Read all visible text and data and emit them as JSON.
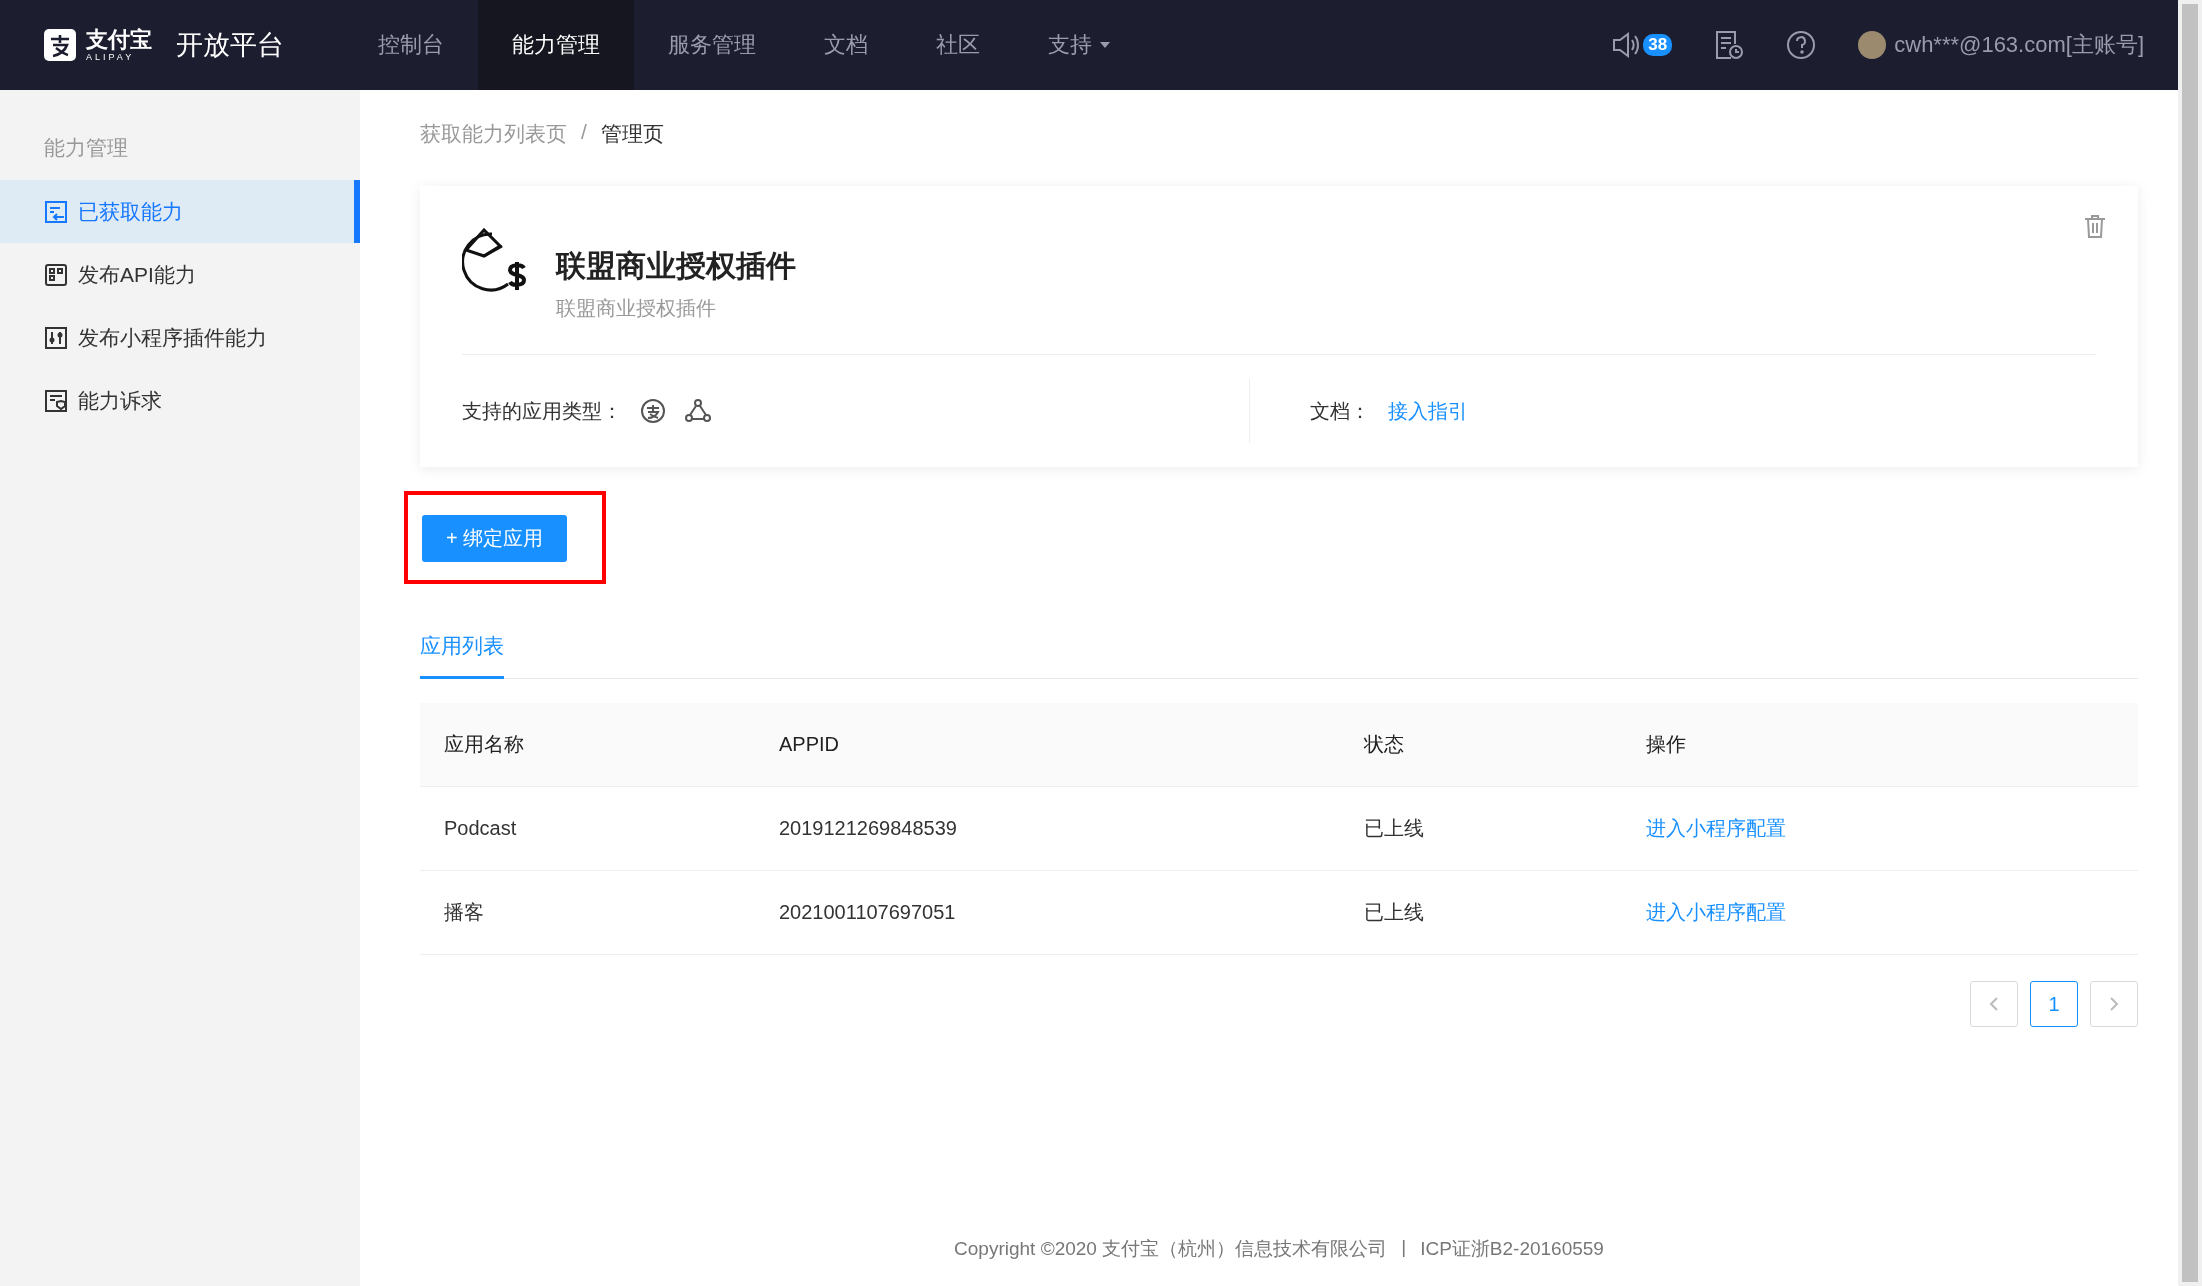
{
  "logo": {
    "mark": "支付宝",
    "sub": "ALIPAY",
    "product": "开放平台"
  },
  "nav": [
    {
      "label": "控制台",
      "selected": false,
      "dropdown": false
    },
    {
      "label": "能力管理",
      "selected": true,
      "dropdown": false
    },
    {
      "label": "服务管理",
      "selected": false,
      "dropdown": false
    },
    {
      "label": "文档",
      "selected": false,
      "dropdown": false
    },
    {
      "label": "社区",
      "selected": false,
      "dropdown": false
    },
    {
      "label": "支持",
      "selected": false,
      "dropdown": true
    }
  ],
  "notifications": {
    "count": "38"
  },
  "user": {
    "name": "cwh***@163.com[主账号]"
  },
  "sidebar": {
    "title": "能力管理",
    "items": [
      {
        "label": "已获取能力",
        "kind": "acquired",
        "selected": true
      },
      {
        "label": "发布API能力",
        "kind": "api",
        "selected": false
      },
      {
        "label": "发布小程序插件能力",
        "kind": "plugin",
        "selected": false
      },
      {
        "label": "能力诉求",
        "kind": "request",
        "selected": false
      }
    ]
  },
  "breadcrumb": {
    "items": [
      "获取能力列表页",
      "管理页"
    ],
    "separator": "/"
  },
  "card": {
    "title": "联盟商业授权插件",
    "subtitle": "联盟商业授权插件",
    "app_types_label": "支持的应用类型：",
    "doc_label": "文档：",
    "doc_link": "接入指引"
  },
  "bind_button": {
    "label": "+ 绑定应用",
    "highlighted": true
  },
  "tabs": [
    {
      "label": "应用列表",
      "selected": true
    }
  ],
  "table": {
    "columns": [
      "应用名称",
      "APPID",
      "状态",
      "操作"
    ],
    "rows": [
      {
        "cells": [
          "Podcast",
          "2019121269848539",
          "已上线"
        ],
        "action": "进入小程序配置"
      },
      {
        "cells": [
          "播客",
          "2021001107697051",
          "已上线"
        ],
        "action": "进入小程序配置"
      }
    ]
  },
  "pagination": {
    "pages": [
      {
        "label": "1",
        "selected": true
      }
    ]
  },
  "footer": {
    "copyright": "Copyright ©2020 支付宝（杭州）信息技术有限公司",
    "separator": "|",
    "icp": "ICP证浙B2-20160559"
  }
}
